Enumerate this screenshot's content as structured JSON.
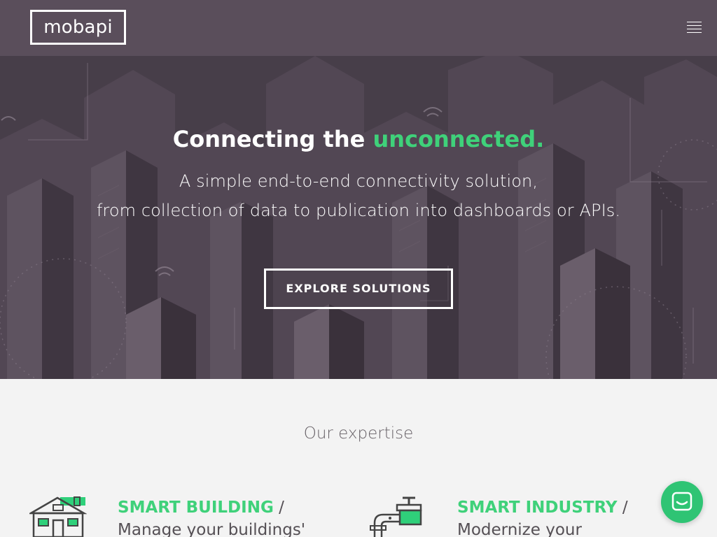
{
  "header": {
    "logo_text": "mobapi",
    "menu_icon": "hamburger-menu-icon"
  },
  "hero": {
    "headline_prefix": "Connecting the",
    "headline_accent": "unconnected.",
    "subtitle_line1": "A simple end-to-end connectivity solution,",
    "subtitle_line2": "from collection of data to publication into dashboards or APIs.",
    "cta_label": "EXPLORE SOLUTIONS"
  },
  "expertise": {
    "title": "Our expertise",
    "items": [
      {
        "icon": "smart-building-icon",
        "title": "SMART BUILDING",
        "separator": " / ",
        "text": "Manage your buildings' energy"
      },
      {
        "icon": "smart-industry-icon",
        "title": "SMART INDUSTRY",
        "separator": " / ",
        "text": "Modernize your"
      }
    ]
  },
  "chat": {
    "icon": "chat-bubble-icon"
  },
  "colors": {
    "header_bg": "#5a4e5b",
    "hero_bg": "#473e49",
    "accent": "#3fd17a",
    "chat_bg": "#2fc474",
    "section_bg": "#f3f3f3"
  }
}
